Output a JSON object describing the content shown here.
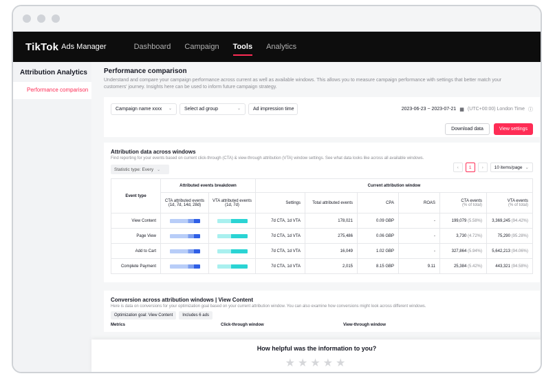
{
  "app": {
    "logo": "TikTok",
    "logo_sub": "Ads Manager"
  },
  "nav": [
    {
      "label": "Dashboard",
      "active": false
    },
    {
      "label": "Campaign",
      "active": false
    },
    {
      "label": "Tools",
      "active": true
    },
    {
      "label": "Analytics",
      "active": false
    }
  ],
  "sidebar": {
    "title": "Attribution Analytics",
    "item": "Performance comparison"
  },
  "page": {
    "title": "Performance comparison",
    "description": "Understand and compare your campaign performance across current as well as available windows. This allows you to measure campaign performance with settings that better match your customers' journey. Insights here can be used to inform future campaign strategy."
  },
  "filters": {
    "campaign": "Campaign name xxxx",
    "ad_group": "Select ad group",
    "ad_time": "Ad impression time",
    "date_range": "2023-06-23 ~ 2023-07-21",
    "timezone": "(UTC+00:00) London Time",
    "download": "Download data",
    "view_settings": "View settings"
  },
  "attribution": {
    "title": "Attribution data across windows",
    "subtitle": "Find reporting for your events based on current click-through (CTA) & view-through attribution (VTA) window settings. See what data looks like across all available windows.",
    "statistic": "Statistic type:  Every",
    "page": "1",
    "per_page": "10 items/page",
    "group_breakdown": "Attributed events breakdown",
    "group_current": "Current attribution window",
    "col_event": "Event type",
    "col_cta": "CTA attributed events (1d, 7d, 14d, 28d)",
    "col_vta": "VTA attributed events (1d, 7d)",
    "col_settings": "Settings",
    "col_total": "Total attributed events",
    "col_cpa": "CPA",
    "col_roas": "ROAS",
    "col_cta_events": "CTA events",
    "col_cta_sub": "(% of total)",
    "col_vta_events": "VTA events",
    "col_vta_sub": "(% of total)",
    "rows": [
      {
        "event": "View Content",
        "settings": "7d CTA, 1d VTA",
        "total": "178,021",
        "cpa": "0.09 GBP",
        "roas": "-",
        "cta": "199,079",
        "cta_pct": "(5.58%)",
        "vta": "3,369,245",
        "vta_pct": "(94.42%)"
      },
      {
        "event": "Page View",
        "settings": "7d CTA, 1d VTA",
        "total": "275,486",
        "cpa": "0.06 GBP",
        "roas": "-",
        "cta": "3,730",
        "cta_pct": "(4.72%)",
        "vta": "75,290",
        "vta_pct": "(95.28%)"
      },
      {
        "event": "Add to Cart",
        "settings": "7d CTA, 1d VTA",
        "total": "16,049",
        "cpa": "1.02 GBP",
        "roas": "-",
        "cta": "327,864",
        "cta_pct": "(5.94%)",
        "vta": "5,642,213",
        "vta_pct": "(94.06%)"
      },
      {
        "event": "Complete Payment",
        "settings": "7d CTA, 1d VTA",
        "total": "2,015",
        "cpa": "8.15 GBP",
        "roas": "9.11",
        "cta": "25,384",
        "cta_pct": "(5.42%)",
        "vta": "443,321",
        "vta_pct": "(94.58%)"
      }
    ]
  },
  "conversion": {
    "title": "Conversion across attribution windows | View Content",
    "subtitle": "Here is data on conversions for your optimization goal based on your current attribution window. You can also examine how conversions might look across different windows.",
    "chip_goal": "Optimization goal: View Content",
    "chip_ads": "Includes 6 ads",
    "col_metrics": "Metrics",
    "col_click": "Click-through window",
    "col_view": "View-through window"
  },
  "feedback": {
    "title": "How helpful was the information to you?",
    "stars": "★★★★★"
  },
  "colors": {
    "accent": "#fe2c55",
    "cta_bar": "#2f5fe6",
    "vta_bar": "#2ad4d4"
  }
}
